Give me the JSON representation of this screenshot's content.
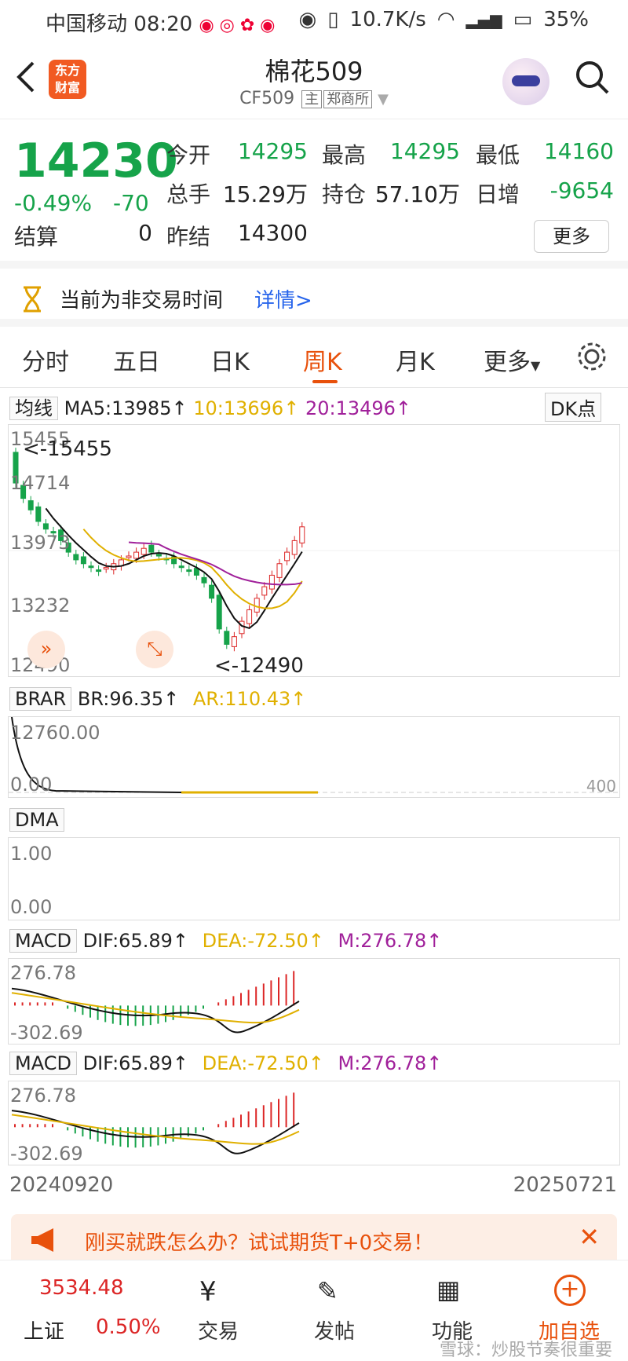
{
  "status_bar": {
    "carrier": "中国移动",
    "time": "08:20",
    "speed": "10.7K/s",
    "signal": "4G",
    "battery": "35%"
  },
  "header": {
    "back_icon": "chevron-left-icon",
    "brand_logo_text": "东方财富",
    "title": "棉花509",
    "code": "CF509",
    "tag_main": "主",
    "exchange": "郑商所",
    "search_icon": "search-icon"
  },
  "quote": {
    "price": "14230",
    "change_pct": "-0.49%",
    "change": "-70",
    "open_label": "今开",
    "open": "14295",
    "high_label": "最高",
    "high": "14295",
    "low_label": "最低",
    "low": "14160",
    "volume_label": "总手",
    "volume": "15.29万",
    "oi_label": "持仓",
    "oi": "57.10万",
    "daily_inc_label": "日增",
    "daily_inc": "-9654",
    "settle_label": "结算",
    "settle": "0",
    "prev_settle_label": "昨结",
    "prev_settle": "14300",
    "more_button": "更多"
  },
  "notice": {
    "text": "当前为非交易时间",
    "link": "详情>"
  },
  "tabs": [
    "分时",
    "五日",
    "日K",
    "周K",
    "月K",
    "更多"
  ],
  "active_tab": "周K",
  "kline": {
    "ma_selector": "均线",
    "ma5": "MA5:13985↑",
    "ma10": "10:13696↑",
    "ma20": "20:13496↑",
    "dk_button": "DK点",
    "y_ticks": [
      "15455",
      "14714",
      "13973",
      "13232",
      "12490"
    ],
    "high_marker": "<-15455",
    "low_marker": "<-12490"
  },
  "brar": {
    "selector": "BRAR",
    "br": "BR:96.35↑",
    "ar": "AR:110.43↑",
    "y_top": "12760.00",
    "y_bottom": "0.00",
    "right_label": "400"
  },
  "dma": {
    "selector": "DMA",
    "y_top": "1.00",
    "y_bottom": "0.00"
  },
  "macd1": {
    "selector": "MACD",
    "dif": "DIF:65.89↑",
    "dea": "DEA:-72.50↑",
    "m": "M:276.78↑",
    "y_top": "276.78",
    "y_bottom": "-302.69"
  },
  "macd2": {
    "selector": "MACD",
    "dif": "DIF:65.89↑",
    "dea": "DEA:-72.50↑",
    "m": "M:276.78↑",
    "y_top": "276.78",
    "y_bottom": "-302.69"
  },
  "x_axis": {
    "start": "20240920",
    "end": "20250721"
  },
  "banner": {
    "text": "刚买就跌怎么办？试试期货T+0交易！"
  },
  "bottom_nav": {
    "index_value": "3534.48",
    "index_name": "上证",
    "index_change": "0.50%",
    "items": [
      "交易",
      "发帖",
      "功能",
      "加自选"
    ],
    "watermark": "雪球：炒股节奏很重要"
  },
  "colors": {
    "up": "#dc2626",
    "down": "#16a34a",
    "accent": "#e8510c",
    "ma10": "#e0b000",
    "ma20": "#a0209a"
  }
}
